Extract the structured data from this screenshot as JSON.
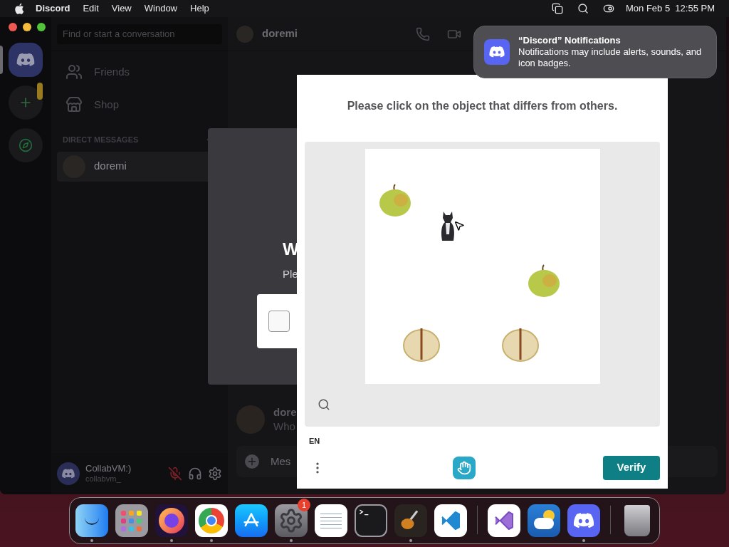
{
  "menu_bar": {
    "app": "Discord",
    "items": [
      "Edit",
      "View",
      "Window",
      "Help"
    ],
    "clock": "Mon Feb 5  12:55 PM"
  },
  "servers": [
    {
      "kind": "home",
      "selected": true
    },
    {
      "kind": "add",
      "selected": false
    },
    {
      "kind": "explore",
      "selected": false
    }
  ],
  "sidebar": {
    "search_placeholder": "Find or start a conversation",
    "nav": [
      {
        "kind": "friends",
        "label": "Friends"
      },
      {
        "kind": "shop",
        "label": "Shop"
      }
    ],
    "dm_header": "DIRECT MESSAGES",
    "dms": [
      {
        "name": "doremi",
        "selected": true
      }
    ],
    "user": {
      "name": "CollabVM:)",
      "handle": "collabvm_",
      "muted": true
    }
  },
  "chat": {
    "title": "doremi",
    "message": {
      "author": "dore",
      "text": "Who"
    },
    "input_placeholder": "Mes"
  },
  "modal": {
    "title": "W",
    "subtitle": "Ple",
    "checked": false
  },
  "captcha": {
    "prompt": "Please click on the object that differs from others.",
    "objects": [
      {
        "kind": "apple"
      },
      {
        "kind": "cat"
      },
      {
        "kind": "apple"
      },
      {
        "kind": "half-apple"
      },
      {
        "kind": "half-apple"
      }
    ],
    "language": "EN",
    "button": "Verify"
  },
  "notification": {
    "title": "“Discord” Notifications",
    "body": "Notifications may include alerts, sounds, and icon badges."
  },
  "dock": [
    {
      "kind": "finder",
      "running": true
    },
    {
      "kind": "launchpad",
      "running": false
    },
    {
      "kind": "firefox",
      "running": true
    },
    {
      "kind": "chrome",
      "running": true
    },
    {
      "kind": "appstore",
      "running": false
    },
    {
      "kind": "settings",
      "running": true,
      "badge": "1"
    },
    {
      "kind": "textedit",
      "running": false
    },
    {
      "kind": "terminal",
      "running": false
    },
    {
      "kind": "guitar",
      "running": true
    },
    {
      "kind": "vscode",
      "running": false
    },
    {
      "kind": "separator"
    },
    {
      "kind": "vs",
      "running": false
    },
    {
      "kind": "weather",
      "running": false
    },
    {
      "kind": "discord",
      "running": true
    },
    {
      "kind": "separator"
    },
    {
      "kind": "trash",
      "running": false
    }
  ]
}
